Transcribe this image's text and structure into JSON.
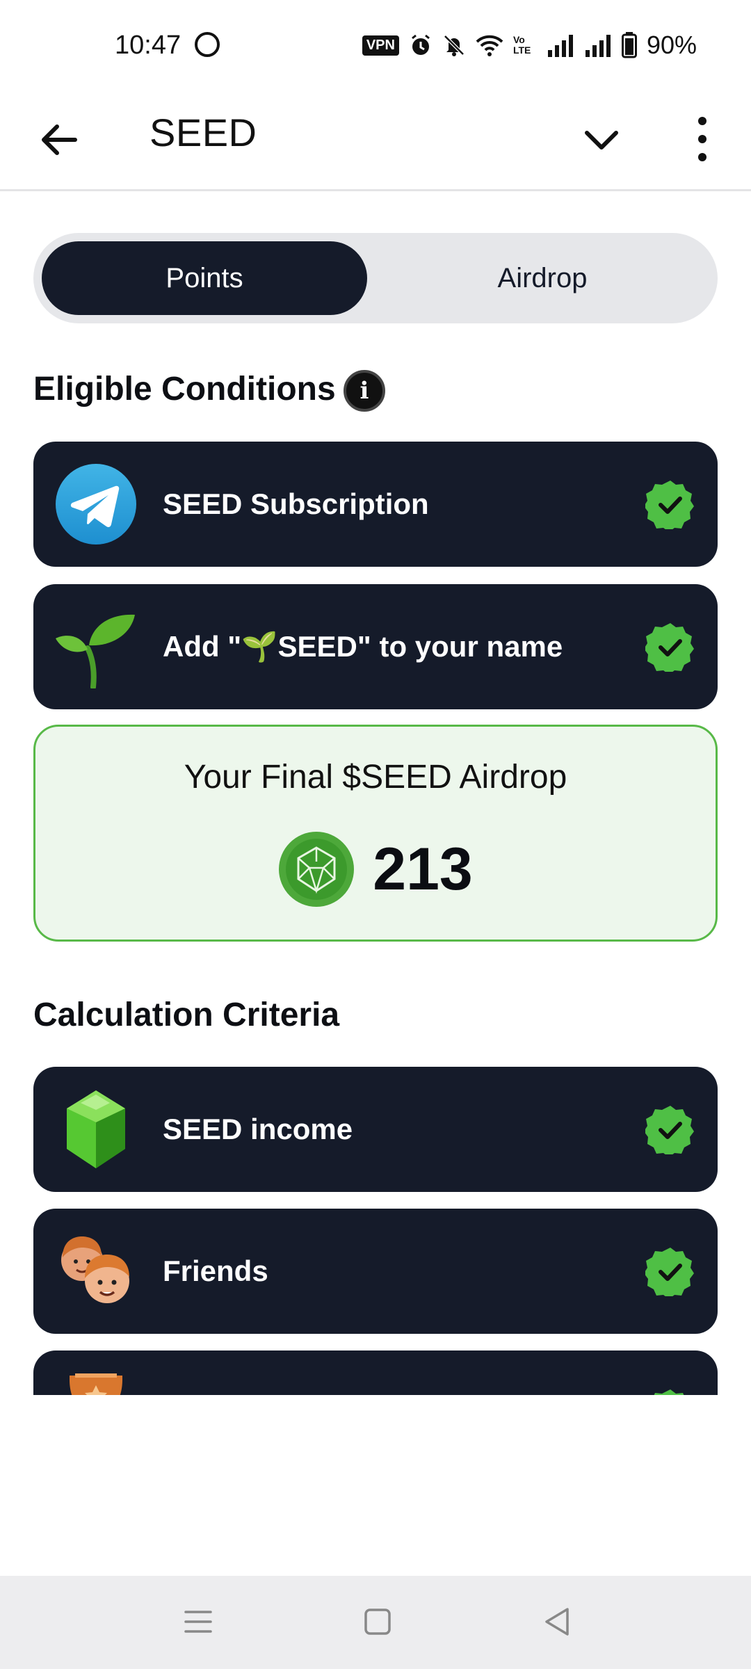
{
  "status_bar": {
    "time": "10:47",
    "vpn_label": "VPN",
    "volte_label": "Vo LTE",
    "battery": "90%",
    "icons": [
      "whatsapp-icon",
      "vpn-icon",
      "alarm-icon",
      "mute-icon",
      "wifi-icon",
      "volte-icon",
      "signal-icon",
      "signal-icon",
      "battery-icon"
    ]
  },
  "app_bar": {
    "title": "SEED",
    "back_icon": "arrow-left-icon",
    "expand_icon": "chevron-down-icon",
    "menu_icon": "more-vertical-icon"
  },
  "tabs": [
    {
      "label": "Points",
      "active": true
    },
    {
      "label": "Airdrop",
      "active": false
    }
  ],
  "eligible": {
    "title": "Eligible Conditions",
    "info_glyph": "i",
    "items": [
      {
        "label": "SEED Subscription",
        "icon": "telegram-icon",
        "done": true
      },
      {
        "label": "Add \"🌱SEED\" to your name",
        "icon": "sprout-icon",
        "done": true
      }
    ]
  },
  "airdrop": {
    "title": "Your Final $SEED Airdrop",
    "amount": "213",
    "icon": "seed-coin-icon"
  },
  "criteria": {
    "title": "Calculation Criteria",
    "items": [
      {
        "label": "SEED income",
        "icon": "green-gem-icon",
        "done": true
      },
      {
        "label": "Friends",
        "icon": "friends-icon",
        "done": true
      },
      {
        "label": "",
        "icon": "trophy-icon",
        "done": true
      }
    ]
  },
  "nav_bar": {
    "icons": [
      "menu-icon",
      "home-icon",
      "back-triangle-icon"
    ]
  },
  "colors": {
    "card_bg": "#151b2a",
    "check_green": "#4fbf45",
    "airdrop_bg": "#edf7ec",
    "airdrop_border": "#58b948"
  }
}
